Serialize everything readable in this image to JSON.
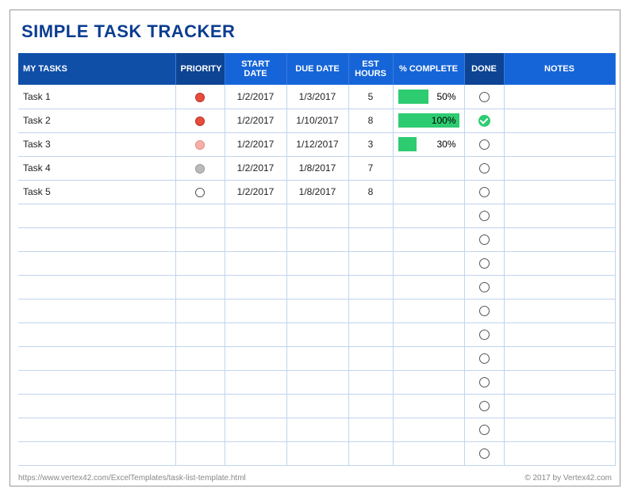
{
  "title": "SIMPLE TASK TRACKER",
  "headers": {
    "tasks": "MY TASKS",
    "priority": "PRIORITY",
    "start": "START DATE",
    "due": "DUE DATE",
    "est": "EST HOURS",
    "pct": "% COMPLETE",
    "done": "DONE",
    "notes": "NOTES"
  },
  "rows": [
    {
      "name": "Task 1",
      "priority": "red",
      "start": "1/2/2017",
      "due": "1/3/2017",
      "est": "5",
      "pct": 50,
      "pct_label": "50%",
      "done": false,
      "notes": ""
    },
    {
      "name": "Task 2",
      "priority": "red",
      "start": "1/2/2017",
      "due": "1/10/2017",
      "est": "8",
      "pct": 100,
      "pct_label": "100%",
      "done": true,
      "notes": ""
    },
    {
      "name": "Task 3",
      "priority": "pink",
      "start": "1/2/2017",
      "due": "1/12/2017",
      "est": "3",
      "pct": 30,
      "pct_label": "30%",
      "done": false,
      "notes": ""
    },
    {
      "name": "Task 4",
      "priority": "gray",
      "start": "1/2/2017",
      "due": "1/8/2017",
      "est": "7",
      "pct": null,
      "pct_label": "",
      "done": false,
      "notes": ""
    },
    {
      "name": "Task 5",
      "priority": "empty",
      "start": "1/2/2017",
      "due": "1/8/2017",
      "est": "8",
      "pct": null,
      "pct_label": "",
      "done": false,
      "notes": ""
    },
    {
      "name": "",
      "priority": "",
      "start": "",
      "due": "",
      "est": "",
      "pct": null,
      "pct_label": "",
      "done": false,
      "notes": ""
    },
    {
      "name": "",
      "priority": "",
      "start": "",
      "due": "",
      "est": "",
      "pct": null,
      "pct_label": "",
      "done": false,
      "notes": ""
    },
    {
      "name": "",
      "priority": "",
      "start": "",
      "due": "",
      "est": "",
      "pct": null,
      "pct_label": "",
      "done": false,
      "notes": ""
    },
    {
      "name": "",
      "priority": "",
      "start": "",
      "due": "",
      "est": "",
      "pct": null,
      "pct_label": "",
      "done": false,
      "notes": ""
    },
    {
      "name": "",
      "priority": "",
      "start": "",
      "due": "",
      "est": "",
      "pct": null,
      "pct_label": "",
      "done": false,
      "notes": ""
    },
    {
      "name": "",
      "priority": "",
      "start": "",
      "due": "",
      "est": "",
      "pct": null,
      "pct_label": "",
      "done": false,
      "notes": ""
    },
    {
      "name": "",
      "priority": "",
      "start": "",
      "due": "",
      "est": "",
      "pct": null,
      "pct_label": "",
      "done": false,
      "notes": ""
    },
    {
      "name": "",
      "priority": "",
      "start": "",
      "due": "",
      "est": "",
      "pct": null,
      "pct_label": "",
      "done": false,
      "notes": ""
    },
    {
      "name": "",
      "priority": "",
      "start": "",
      "due": "",
      "est": "",
      "pct": null,
      "pct_label": "",
      "done": false,
      "notes": ""
    },
    {
      "name": "",
      "priority": "",
      "start": "",
      "due": "",
      "est": "",
      "pct": null,
      "pct_label": "",
      "done": false,
      "notes": ""
    },
    {
      "name": "",
      "priority": "",
      "start": "",
      "due": "",
      "est": "",
      "pct": null,
      "pct_label": "",
      "done": false,
      "notes": ""
    }
  ],
  "footer": {
    "left": "https://www.vertex42.com/ExcelTemplates/task-list-template.html",
    "right": "© 2017 by Vertex42.com"
  },
  "chart_data": {
    "type": "table",
    "columns": [
      "MY TASKS",
      "PRIORITY",
      "START DATE",
      "DUE DATE",
      "EST HOURS",
      "% COMPLETE",
      "DONE",
      "NOTES"
    ],
    "rows": [
      [
        "Task 1",
        "high",
        "1/2/2017",
        "1/3/2017",
        5,
        50,
        false,
        ""
      ],
      [
        "Task 2",
        "high",
        "1/2/2017",
        "1/10/2017",
        8,
        100,
        true,
        ""
      ],
      [
        "Task 3",
        "medium",
        "1/2/2017",
        "1/12/2017",
        3,
        30,
        false,
        ""
      ],
      [
        "Task 4",
        "low",
        "1/2/2017",
        "1/8/2017",
        7,
        null,
        false,
        ""
      ],
      [
        "Task 5",
        "none",
        "1/2/2017",
        "1/8/2017",
        8,
        null,
        false,
        ""
      ]
    ]
  }
}
